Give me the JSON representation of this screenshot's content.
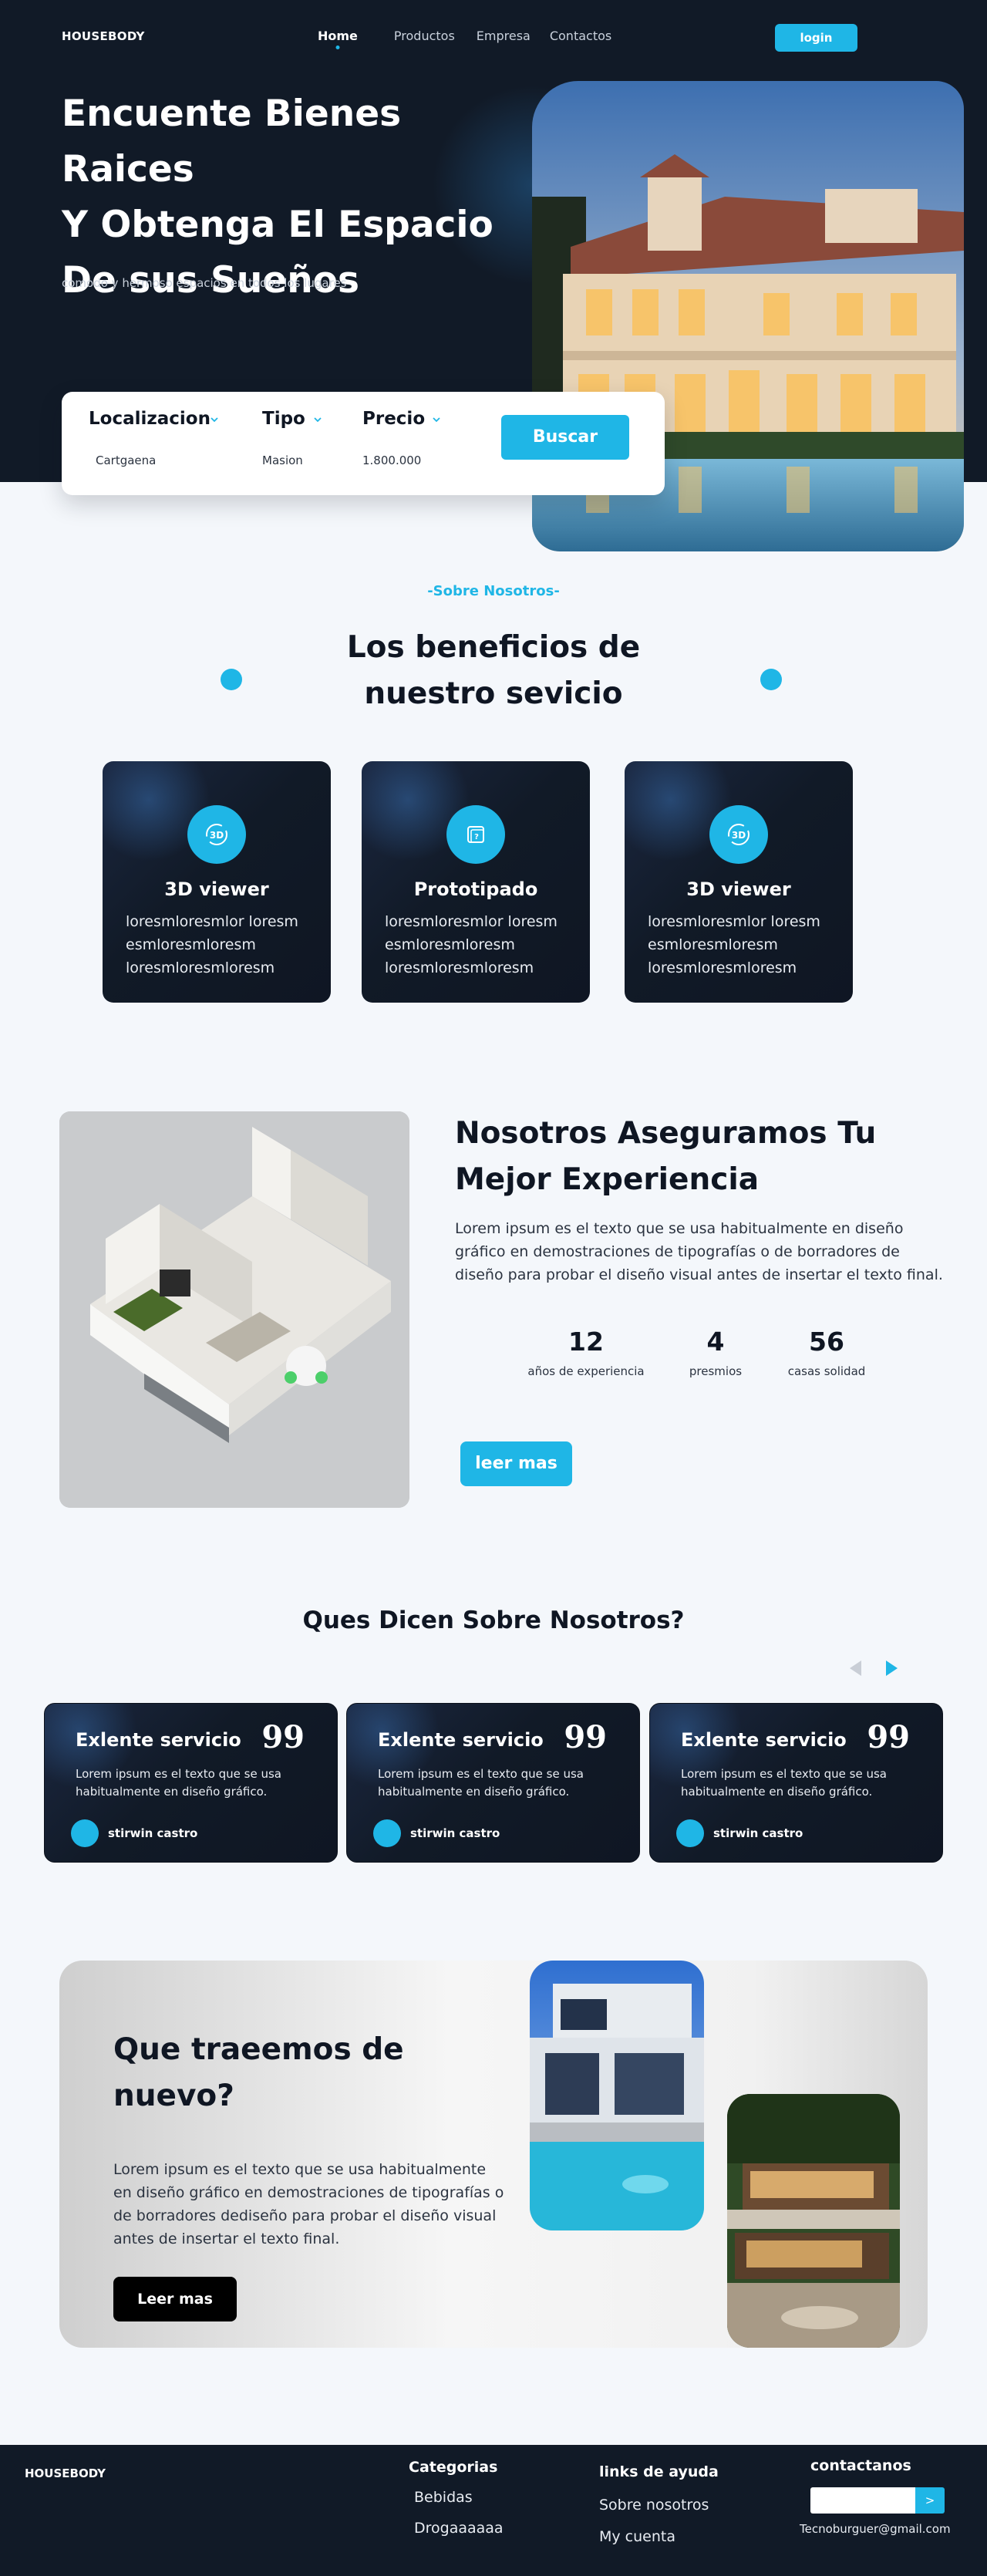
{
  "nav": {
    "logo": "HOUSEBODY",
    "links": [
      "Home",
      "Productos",
      "Empresa",
      "Contactos"
    ],
    "login": "login"
  },
  "hero": {
    "title_lines": [
      "Encuente Bienes Raices",
      "Y Obtenga El Espacio",
      "De sus Sueños"
    ],
    "subtitle": "comodo y hermoso espacios en todos los lugares"
  },
  "search": {
    "fields": [
      {
        "label": "Localizacion",
        "value": "Cartgaena"
      },
      {
        "label": "Tipo",
        "value": "Masion"
      },
      {
        "label": "Precio",
        "value": "1.800.000"
      }
    ],
    "button": "Buscar"
  },
  "about": {
    "tag": "-Sobre Nosotros-",
    "title_lines": [
      "Los beneficios de",
      "nuestro sevicio"
    ],
    "features": [
      {
        "icon": "3d-rotate-icon",
        "title": "3D viewer",
        "text": "loresmloresmlor loresm esmloresmloresm loresmloresmloresm"
      },
      {
        "icon": "prototype-icon",
        "title": "Prototipado",
        "text": "loresmloresmlor loresm esmloresmloresm loresmloresmloresm"
      },
      {
        "icon": "3d-rotate-icon",
        "title": "3D viewer",
        "text": "loresmloresmlor loresm esmloresmloresm loresmloresmloresm"
      }
    ]
  },
  "experience": {
    "title_lines": [
      "Nosotros Aseguramos Tu",
      "Mejor Experiencia"
    ],
    "text": "Lorem ipsum es el texto que se usa habitualmente en diseño gráfico en demostraciones de tipografías o de borradores de diseño para probar el diseño visual antes de insertar el texto final.",
    "stats": [
      {
        "value": "12",
        "label": "años de experiencia"
      },
      {
        "value": "4",
        "label": "presmios"
      },
      {
        "value": "56",
        "label": "casas solidad"
      }
    ],
    "button": "leer mas"
  },
  "testimonials": {
    "title": "Ques Dicen Sobre Nosotros?",
    "quote_mark": "99",
    "cards": [
      {
        "title": "Exlente servicio",
        "text": "Lorem ipsum es el texto que se usa habitualmente en diseño gráfico.",
        "name": "stirwin castro"
      },
      {
        "title": "Exlente servicio",
        "text": "Lorem ipsum es el texto que se usa habitualmente en diseño gráfico.",
        "name": "stirwin castro"
      },
      {
        "title": "Exlente servicio",
        "text": "Lorem ipsum es el texto que se usa habitualmente en diseño gráfico.",
        "name": "stirwin castro"
      }
    ]
  },
  "new": {
    "title_lines": [
      "Que traeemos de",
      "nuevo?"
    ],
    "text": "Lorem ipsum es el texto que se usa habitualmente en diseño gráfico en demostraciones de tipografías o de borradores dediseño para probar el diseño visual antes de insertar el texto final.",
    "button": "Leer mas"
  },
  "footer": {
    "logo": "HOUSEBODY",
    "categorias": {
      "title": "Categorias",
      "items": [
        "Bebidas",
        "Drogaaaaaa"
      ]
    },
    "ayuda": {
      "title": "links de ayuda",
      "items": [
        "Sobre nosotros",
        "My cuenta"
      ]
    },
    "contacto": {
      "title": "contactanos",
      "button": ">",
      "email": "Tecnoburguer@gmail.com"
    }
  },
  "colors": {
    "accent": "#1fb6e6",
    "dark": "#111a27",
    "background": "#f4f7fb"
  }
}
